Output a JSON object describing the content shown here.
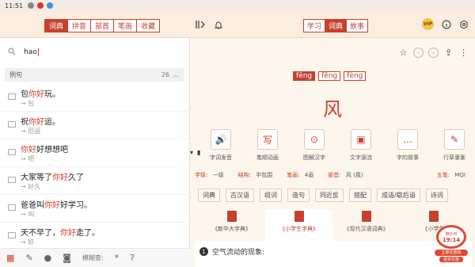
{
  "status": {
    "time": "11:51"
  },
  "top_tabs": [
    "词典",
    "拼音",
    "部首",
    "笔画",
    "收藏"
  ],
  "mode_tabs": [
    "学习",
    "词典",
    "故事"
  ],
  "vip": "VIP",
  "search": {
    "value": "hao"
  },
  "examples_section": {
    "title": "例句",
    "count": "26"
  },
  "examples": [
    {
      "pre": "包",
      "hl": "你好",
      "post": "玩。",
      "tr": "→ 包"
    },
    {
      "pre": "祝",
      "hl": "你好",
      "post": "运。",
      "tr": "→ 厄运"
    },
    {
      "pre": "",
      "hl": "你好",
      "post": "好想想吧",
      "tr": "→ 吧"
    },
    {
      "pre": "大家等了",
      "hl": "你好",
      "post": "久了",
      "tr": "→ 好久"
    },
    {
      "pre": "爸爸叫",
      "hl": "你好",
      "post": "好学习。",
      "tr": "→ 叫"
    },
    {
      "pre": "天不早了，",
      "hl": "你好",
      "post": "走了。",
      "tr": "→ 好"
    }
  ],
  "bottom": {
    "fuzzy": "模糊查:",
    "star": "*",
    "question": "?"
  },
  "pinyins": [
    "fēng",
    "fěng",
    "fèng"
  ],
  "character": "风",
  "tools": [
    "字词发音",
    "笔顺动画",
    "图解汉字",
    "文字源流",
    "字的故事",
    "行草隶篆"
  ],
  "tool_glyphs": [
    "🔊",
    "写",
    "⊙",
    "▣",
    "…",
    "✎"
  ],
  "info": [
    {
      "k": "字级:",
      "v": "一级"
    },
    {
      "k": "结构:",
      "v": "半包围"
    },
    {
      "k": "笔画:",
      "v": "4画"
    },
    {
      "k": "部首:",
      "v": "风 (風)"
    },
    {
      "k": "五笔:",
      "v": "MQI"
    }
  ],
  "chips": [
    "词典",
    "古汉语",
    "组词",
    "造句",
    "同近反",
    "搭配",
    "成语/歇后语",
    "诗词"
  ],
  "dicts": [
    "《新华大字典》",
    "《小学生字典》",
    "《现代汉语词典》",
    "《小学生"
  ],
  "definition": {
    "num": "1",
    "text": "空气流动的现象:"
  },
  "promo": {
    "top": "倒计时",
    "time": "19:14",
    "b1": "立即优惠购",
    "b2": "更多优惠"
  },
  "colors": {
    "accent": "#c8402e"
  }
}
